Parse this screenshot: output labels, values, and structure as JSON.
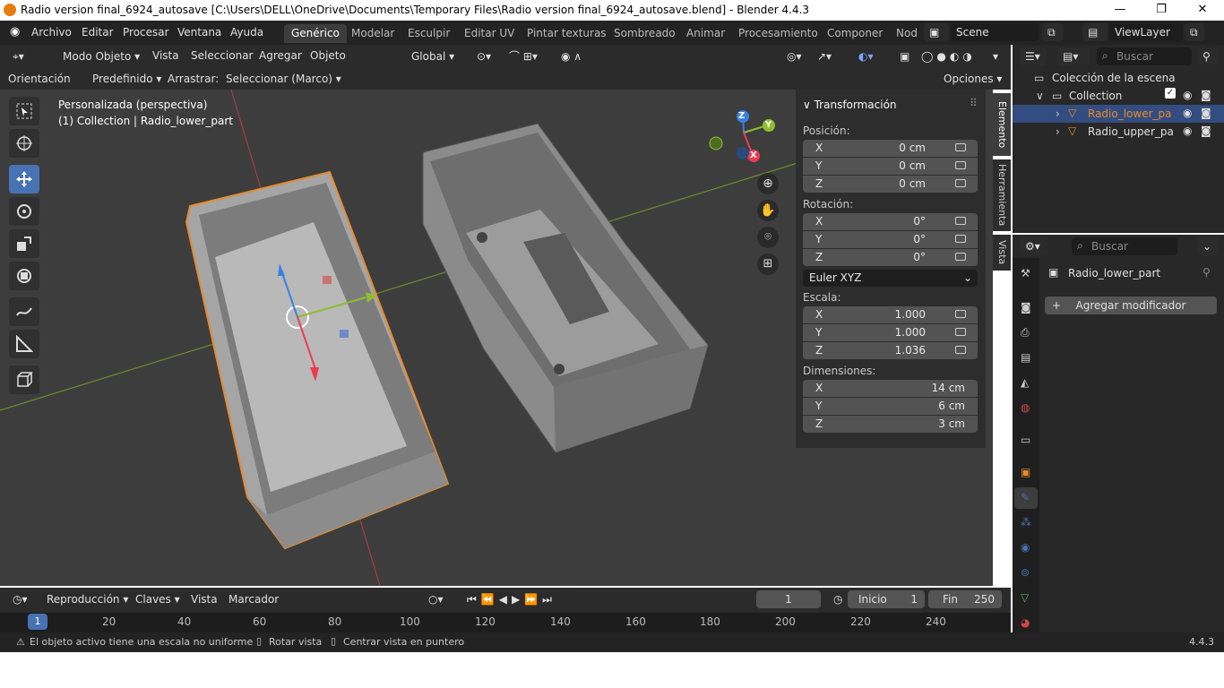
{
  "window": {
    "title": "Radio version final_6924_autosave [C:\\Users\\DELL\\OneDrive\\Documents\\Temporary Files\\Radio version final_6924_autosave.blend] - Blender 4.4.3",
    "minimize": "—",
    "maximize": "❐",
    "close": "✕"
  },
  "menu": {
    "items": [
      "Archivo",
      "Editar",
      "Procesar",
      "Ventana",
      "Ayuda"
    ],
    "workspaces": [
      "Genérico",
      "Modelar",
      "Esculpir",
      "Editar UV",
      "Pintar texturas",
      "Sombreado",
      "Animar",
      "Procesamiento",
      "Componer",
      "Nod"
    ],
    "scene": "Scene",
    "view_layer": "ViewLayer"
  },
  "viewport_header": {
    "mode": "Modo Objeto",
    "menus": [
      "Vista",
      "Seleccionar",
      "Agregar",
      "Objeto"
    ],
    "transform_orientation": "Global"
  },
  "tool_header": {
    "orientation_label": "Orientación:",
    "orientation_value": "Predefinido",
    "drag_label": "Arrastrar:",
    "drag_value": "Seleccionar (Marco)",
    "options": "Opciones"
  },
  "viewport": {
    "view_name": "Personalizada (perspectiva)",
    "selection": "(1) Collection | Radio_lower_part",
    "gizmo": {
      "x": "X",
      "y": "Y",
      "z": "Z"
    }
  },
  "npanel": {
    "header": "Transformación",
    "position_label": "Posición:",
    "position": [
      {
        "axis": "X",
        "value": "0 cm"
      },
      {
        "axis": "Y",
        "value": "0 cm"
      },
      {
        "axis": "Z",
        "value": "0 cm"
      }
    ],
    "rotation_label": "Rotación:",
    "rotation": [
      {
        "axis": "X",
        "value": "0°"
      },
      {
        "axis": "Y",
        "value": "0°"
      },
      {
        "axis": "Z",
        "value": "0°"
      }
    ],
    "rotation_mode": "Euler XYZ",
    "scale_label": "Escala:",
    "scale": [
      {
        "axis": "X",
        "value": "1.000"
      },
      {
        "axis": "Y",
        "value": "1.000"
      },
      {
        "axis": "Z",
        "value": "1.036"
      }
    ],
    "dimensions_label": "Dimensiones:",
    "dimensions": [
      {
        "axis": "X",
        "value": "14 cm"
      },
      {
        "axis": "Y",
        "value": "6 cm"
      },
      {
        "axis": "Z",
        "value": "3 cm"
      }
    ],
    "tabs": [
      "Elemento",
      "Herramienta",
      "Vista"
    ]
  },
  "timeline": {
    "menus": [
      "Reproducción",
      "Claves",
      "Vista",
      "Marcador"
    ],
    "current_frame": "1",
    "start_label": "Inicio",
    "start": "1",
    "end_label": "Fin",
    "end": "250",
    "ruler": [
      "1",
      "20",
      "40",
      "60",
      "80",
      "100",
      "120",
      "140",
      "160",
      "180",
      "200",
      "220",
      "240"
    ]
  },
  "statusbar": {
    "warning": "El objeto activo tiene una escala no uniforme",
    "hint1": "Rotar vista",
    "hint2": "Centrar vista en puntero",
    "version": "4.4.3"
  },
  "outliner": {
    "search_placeholder": "Buscar",
    "scene_collection": "Colección de la escena",
    "collection": "Collection",
    "objects": [
      "Radio_lower_pa",
      "Radio_upper_pa"
    ]
  },
  "properties": {
    "search_placeholder": "Buscar",
    "object_name": "Radio_lower_part",
    "add_modifier": "Agregar modificador"
  },
  "colors": {
    "accent": "#4772b3",
    "selected": "#e88a2a",
    "x_axis": "#ee3b51",
    "y_axis": "#8fbe2e",
    "z_axis": "#3b80e0"
  }
}
